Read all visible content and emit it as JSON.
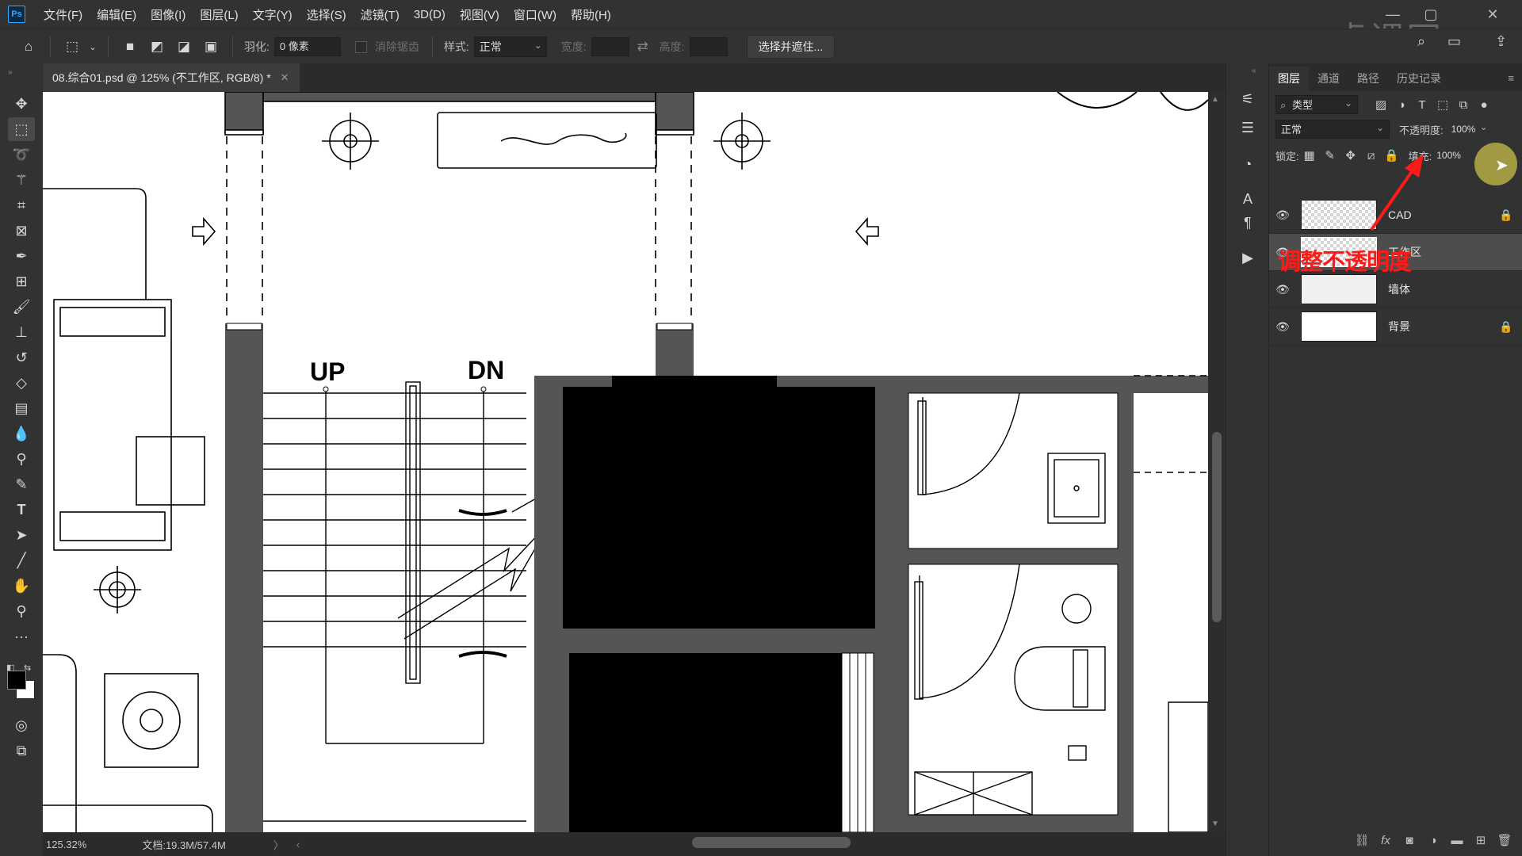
{
  "menu": {
    "app_icon": "Ps",
    "items": [
      "文件(F)",
      "编辑(E)",
      "图像(I)",
      "图层(L)",
      "文字(Y)",
      "选择(S)",
      "滤镜(T)",
      "3D(D)",
      "视图(V)",
      "窗口(W)",
      "帮助(H)"
    ]
  },
  "options": {
    "feather_label": "羽化:",
    "feather_value": "0 像素",
    "antialias_label": "消除锯齿",
    "style_label": "样式:",
    "style_value": "正常",
    "width_label": "宽度:",
    "height_label": "高度:",
    "select_mask_button": "选择并遮住..."
  },
  "document": {
    "tab_title": "08.综合01.psd @ 125% (不工作区, RGB/8) *",
    "zoom": "125.32%",
    "doc_info": "文档:19.3M/57.4M"
  },
  "floorplan": {
    "label_up": "UP",
    "label_dn": "DN"
  },
  "layers_panel": {
    "tabs": [
      "图层",
      "通道",
      "路径",
      "历史记录"
    ],
    "filter_kind": "类型",
    "blend_mode": "正常",
    "opacity_label": "不透明度:",
    "opacity_value": "100%",
    "lock_label": "锁定:",
    "fill_label": "填充:",
    "fill_value": "100%",
    "layers": [
      {
        "name": "CAD",
        "locked": true,
        "selected": false
      },
      {
        "name": "工作区",
        "locked": false,
        "selected": true
      },
      {
        "name": "墙体",
        "locked": false,
        "selected": false
      },
      {
        "name": "背景",
        "locked": true,
        "selected": false
      }
    ]
  },
  "annotation": "调整不透明度",
  "watermark": "虎课网",
  "colors": {
    "annotation_red": "#ff1a1a",
    "ui_dark": "#323232",
    "ps_blue": "#31a8ff"
  }
}
